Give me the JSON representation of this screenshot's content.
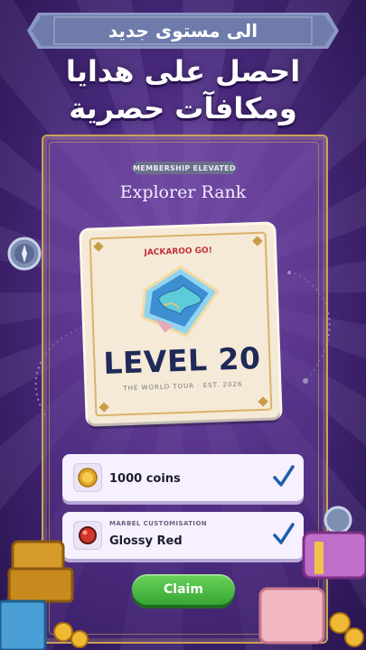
{
  "banner": {
    "text": "الى مستوى جديد"
  },
  "headline": {
    "line1": "احصل على هدايا",
    "line2": "ومكافآت حصرية"
  },
  "card": {
    "ribbon": "MEMBERSHIP ELEVATED",
    "rank_title": "Explorer Rank",
    "brand": "JACKAROO GO!",
    "level": "LEVEL 20",
    "subtitle": "THE WORLD TOUR · EST. 2026"
  },
  "rewards": [
    {
      "category": "",
      "label": "1000 coins",
      "icon": "coin-icon",
      "claimed": true
    },
    {
      "category": "MARBEL CUSTOMISATION",
      "label": "Glossy Red",
      "icon": "red-marble-icon",
      "claimed": true
    }
  ],
  "claim_button": {
    "label": "Claim"
  },
  "colors": {
    "background": "#4a2a80",
    "gold": "#c7a25b",
    "level_text": "#1f2a58",
    "claim_green": "#37a633",
    "check_blue": "#1d5fa8"
  }
}
